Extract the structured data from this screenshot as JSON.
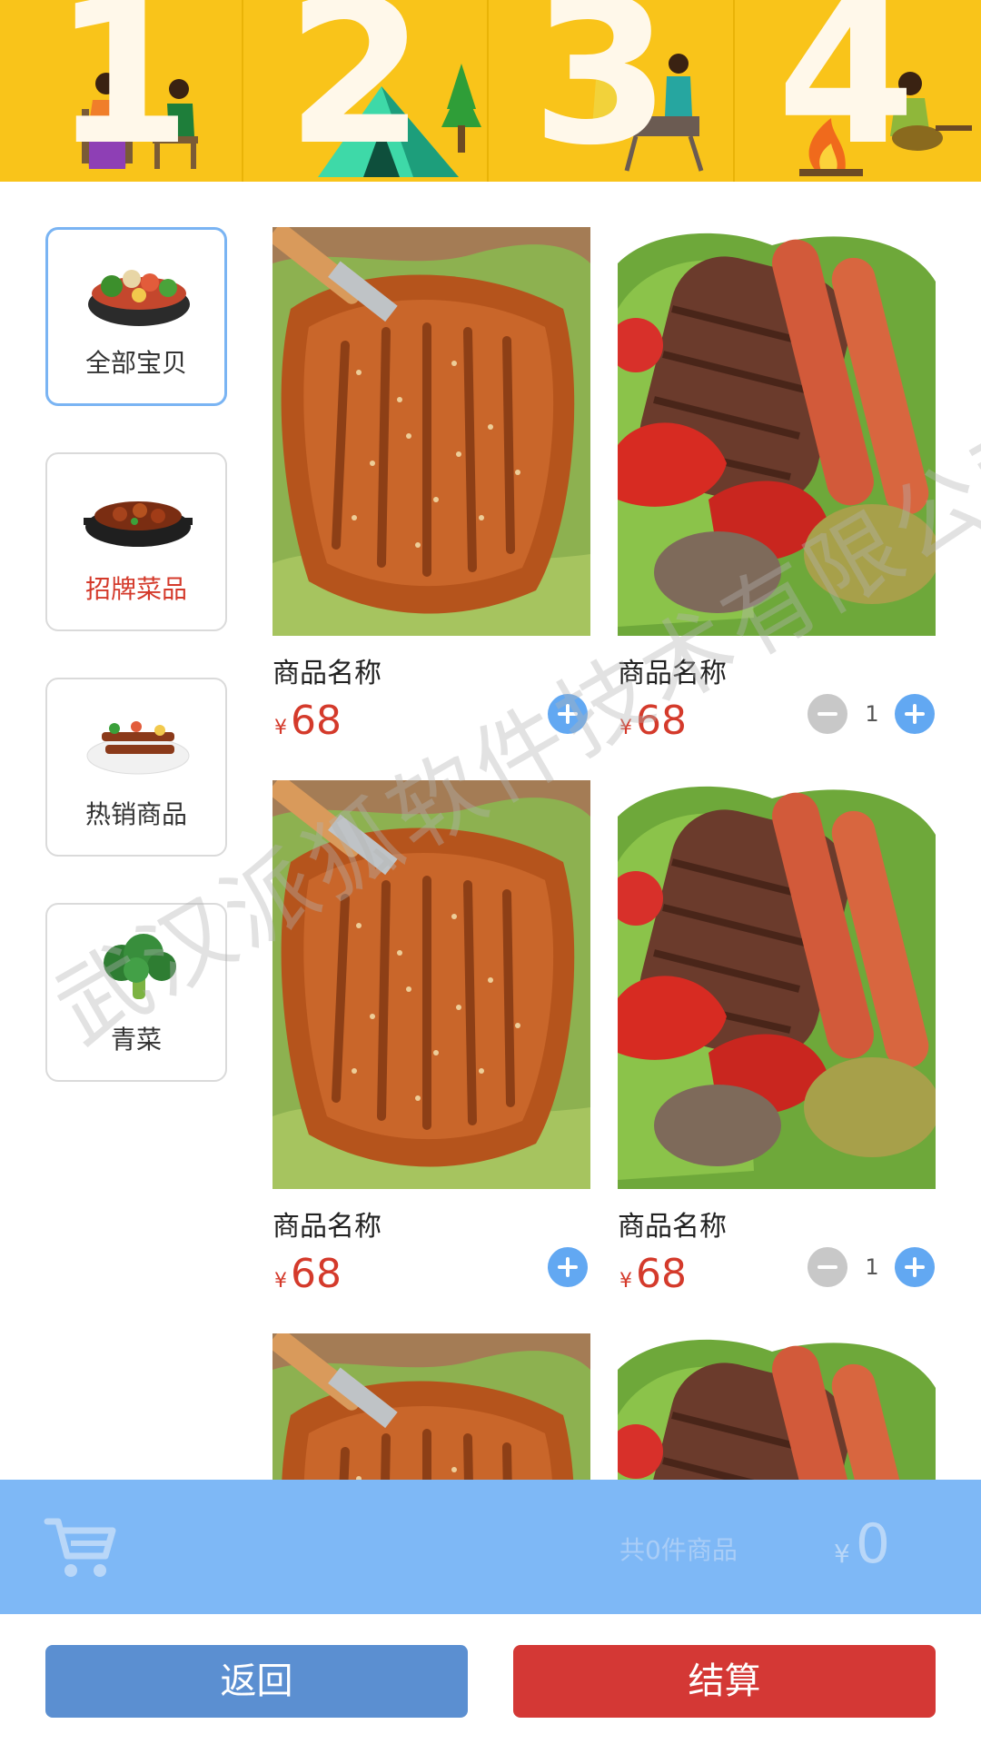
{
  "banner": {
    "numbers": [
      "1",
      "2",
      "3",
      "4"
    ],
    "colors": {
      "background": "#f9c41a",
      "number": "#fff8ea"
    }
  },
  "categories": [
    {
      "label": "全部宝贝",
      "active": true,
      "icon": "hotpot-bowl-icon"
    },
    {
      "label": "招牌菜品",
      "active": false,
      "highlight": "#d43a2b",
      "icon": "braised-dish-icon"
    },
    {
      "label": "热销商品",
      "active": false,
      "icon": "skewers-plate-icon"
    },
    {
      "label": "青菜",
      "active": false,
      "icon": "broccoli-icon"
    }
  ],
  "products": [
    {
      "name": "商品名称",
      "currency": "¥",
      "price": "68",
      "quantity": null,
      "image": "grilled-chop"
    },
    {
      "name": "商品名称",
      "currency": "¥",
      "price": "68",
      "quantity": "1",
      "image": "steak-sausage-platter"
    },
    {
      "name": "商品名称",
      "currency": "¥",
      "price": "68",
      "quantity": null,
      "image": "grilled-chop"
    },
    {
      "name": "商品名称",
      "currency": "¥",
      "price": "68",
      "quantity": "1",
      "image": "steak-sausage-platter"
    },
    {
      "name": "",
      "currency": "",
      "price": "",
      "quantity": null,
      "image": "grilled-chop"
    },
    {
      "name": "",
      "currency": "",
      "price": "",
      "quantity": null,
      "image": "steak-sausage-platter"
    }
  ],
  "cart": {
    "count_text": "共0件商品",
    "currency": "¥",
    "total": "0",
    "icon": "shopping-cart-icon"
  },
  "footer": {
    "back_label": "返回",
    "checkout_label": "结算"
  },
  "watermark": "武汉派狐软件技术有限公司",
  "colors": {
    "accent": "#62a8f2",
    "price": "#d43a2b",
    "cartbar": "#7eb8f6",
    "back": "#5b8fd1",
    "checkout": "#d43835"
  }
}
